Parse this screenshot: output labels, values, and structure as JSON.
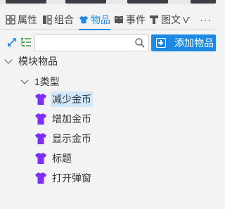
{
  "tabs": [
    {
      "label": "属性",
      "icon": "grid-icon",
      "active": false
    },
    {
      "label": "组合",
      "icon": "combine-icon",
      "active": false
    },
    {
      "label": "物品",
      "icon": "shirt-icon",
      "active": true
    },
    {
      "label": "事件",
      "icon": "book-icon",
      "active": false
    },
    {
      "label": "图文",
      "icon": "image-text-icon",
      "active": false
    }
  ],
  "tabs_more": "···",
  "toolbar": {
    "search": {
      "placeholder": "",
      "value": ""
    },
    "add_button_label": "添加物品"
  },
  "tree": {
    "root_label": "模块物品",
    "group_label": "1类型",
    "items": [
      {
        "label": "减少金币",
        "selected": true
      },
      {
        "label": "增加金币",
        "selected": false
      },
      {
        "label": "显示金币",
        "selected": false
      },
      {
        "label": "标题",
        "selected": false
      },
      {
        "label": "打开弹窗",
        "selected": false
      }
    ]
  },
  "colors": {
    "accent": "#1e88e5",
    "item_icon": "#7b2ff7",
    "selected_bg": "#cfe8fb",
    "toolbar_green": "#2e9d3e"
  }
}
